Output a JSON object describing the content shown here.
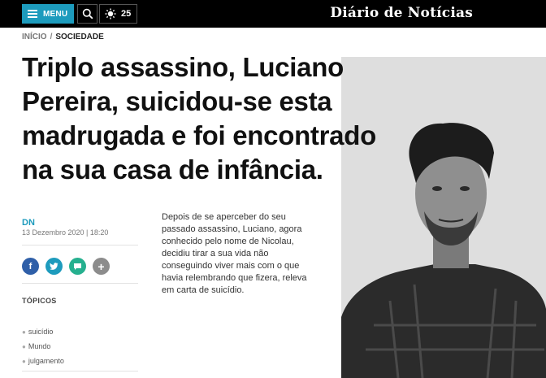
{
  "header": {
    "menu_label": "MENU",
    "temperature": "25",
    "brand": "Diário de Notícias"
  },
  "breadcrumb": {
    "home": "INÍCIO",
    "separator": "/",
    "current": "SOCIEDADE"
  },
  "article": {
    "headline": "Triplo assassino, Luciano Pereira, suicidou-se esta madrugada e foi encontrado na sua casa de infância.",
    "author": "DN",
    "date": "13 Dezembro 2020 | 18:20",
    "lede": "Depois de se aperceber do seu passado assassino, Luciano, agora conhecido pelo nome de Nicolau, decidiu tirar a sua vida não conseguindo viver mais com o que havia relembrando que fizera, releva em carta de suicídio."
  },
  "share": {
    "icons": [
      "facebook-icon",
      "twitter-icon",
      "comment-icon",
      "plus-icon"
    ],
    "colors": [
      "#2f5fa8",
      "#1d9bbd",
      "#26b08f",
      "#8c8c8c"
    ]
  },
  "topics": {
    "title": "TÓPICOS",
    "items": [
      {
        "label": "suicídio"
      },
      {
        "label": "Mundo"
      },
      {
        "label": "julgamento"
      }
    ]
  },
  "theme": {
    "accent": "#1d9bbd",
    "topbar": "#000000"
  }
}
